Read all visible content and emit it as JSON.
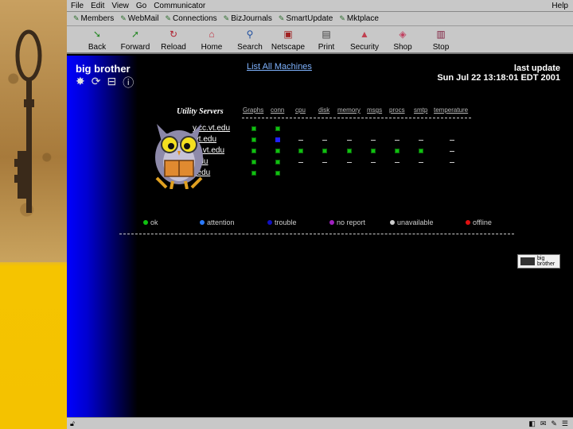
{
  "menu": [
    "File",
    "Edit",
    "View",
    "Go",
    "Communicator"
  ],
  "menu_help": "Help",
  "personal_toolbar": [
    "Members",
    "WebMail",
    "Connections",
    "BizJournals",
    "SmartUpdate",
    "Mktplace"
  ],
  "toolbar": [
    {
      "label": "Back",
      "icon": "back-arrow-icon"
    },
    {
      "label": "Forward",
      "icon": "forward-arrow-icon"
    },
    {
      "label": "Reload",
      "icon": "reload-icon"
    },
    {
      "label": "Home",
      "icon": "home-icon"
    },
    {
      "label": "Search",
      "icon": "search-icon"
    },
    {
      "label": "Netscape",
      "icon": "netscape-icon"
    },
    {
      "label": "Print",
      "icon": "print-icon"
    },
    {
      "label": "Security",
      "icon": "lock-icon"
    },
    {
      "label": "Shop",
      "icon": "shop-icon"
    },
    {
      "label": "Stop",
      "icon": "stop-icon"
    }
  ],
  "page": {
    "logo": "big brother",
    "list_all": "List All Machines",
    "last_update_label": "last update",
    "last_update_value": "Sun Jul 22 13:18:01 EDT 2001",
    "section_title": "Utility Servers",
    "columns": [
      "Graphs",
      "conn",
      "cpu",
      "disk",
      "memory",
      "msgs",
      "procs",
      "smtp",
      "temperature"
    ],
    "hosts": [
      "y.cc.vt.edu",
      ".vt.edu",
      "cc.vt.edu",
      ".edu",
      "t.edu"
    ],
    "status_grid": [
      [
        "green",
        "green",
        "",
        "",
        "",
        "",
        "",
        "",
        ""
      ],
      [
        "green",
        "blue",
        "dash",
        "dash",
        "dash",
        "dash",
        "dash",
        "dash",
        "dash"
      ],
      [
        "green",
        "green",
        "green",
        "green",
        "green",
        "green",
        "green",
        "green",
        "dash"
      ],
      [
        "green",
        "green",
        "dash",
        "dash",
        "dash",
        "dash",
        "dash",
        "dash",
        "dash"
      ],
      [
        "green",
        "green",
        "",
        "",
        "",
        "",
        "",
        "",
        ""
      ]
    ],
    "legend": [
      {
        "label": "ok",
        "color": "#10c010"
      },
      {
        "label": "attention",
        "color": "#2a7bff"
      },
      {
        "label": "trouble",
        "color": "#1010c0"
      },
      {
        "label": "no report",
        "color": "#a020c0"
      },
      {
        "label": "unavailable",
        "color": "#cccccc"
      },
      {
        "label": "offline",
        "color": "#e01010"
      }
    ],
    "badge": "big\nbrother"
  },
  "accent": {
    "menu_bg": "#c8c8c8",
    "content_bg": "#000000",
    "gradient_blue": "#0000ff"
  }
}
